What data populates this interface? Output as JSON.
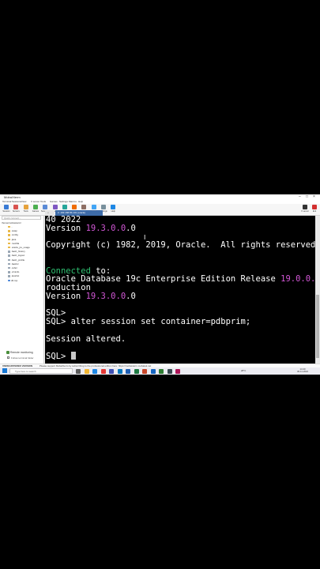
{
  "window": {
    "title": "MobaXterm"
  },
  "menu": [
    "Terminal",
    "Sessions",
    "View",
    "X server",
    "Tools",
    "Games",
    "Settings",
    "Macros",
    "Help"
  ],
  "toolbar": [
    {
      "label": "Session",
      "icon": "session-icon",
      "color": "#3a7bd5"
    },
    {
      "label": "Servers",
      "icon": "servers-icon",
      "color": "#d9534f"
    },
    {
      "label": "Tools",
      "icon": "tools-icon",
      "color": "#e6a23c"
    },
    {
      "label": "Games",
      "icon": "games-icon",
      "color": "#4caf50"
    },
    {
      "label": "Sessions",
      "icon": "sessions-icon",
      "color": "#5b8bd6"
    },
    {
      "label": "View",
      "icon": "view-icon",
      "color": "#7e57c2"
    },
    {
      "label": "Split",
      "icon": "split-icon",
      "color": "#26a69a"
    },
    {
      "label": "MultiExec",
      "icon": "multiexec-icon",
      "color": "#ef6c00"
    },
    {
      "label": "Tunneling",
      "icon": "tunneling-icon",
      "color": "#8d6e63"
    },
    {
      "label": "Packages",
      "icon": "packages-icon",
      "color": "#42a5f5"
    },
    {
      "label": "Settings",
      "icon": "settings-icon",
      "color": "#78909c"
    },
    {
      "label": "Help",
      "icon": "help-icon",
      "color": "#1e88e5"
    }
  ],
  "toolbar_right": [
    {
      "label": "X server",
      "icon": "x-server-icon",
      "color": "#333333"
    },
    {
      "label": "Exit",
      "icon": "exit-icon",
      "color": "#d32f2f"
    }
  ],
  "sidebar": {
    "search_placeholder": "Quick connect...",
    "header": "/home/mobaxterm/",
    "items": [
      {
        "name": "..",
        "type": "folder"
      },
      {
        "name": ".swap",
        "type": "folder"
      },
      {
        "name": ".config",
        "type": "folder"
      },
      {
        "name": ".java",
        "type": "folder"
      },
      {
        "name": ".mozilla",
        "type": "folder"
      },
      {
        "name": ".oracle_jre_usage",
        "type": "folder"
      },
      {
        "name": ".bash_history",
        "type": "file"
      },
      {
        "name": ".bash_logout",
        "type": "file"
      },
      {
        "name": ".bash_profile",
        "type": "file"
      },
      {
        "name": ".bashrc",
        "type": "file"
      },
      {
        "name": ".cshrc",
        "type": "file"
      },
      {
        "name": ".viminfo",
        "type": "file"
      },
      {
        "name": ".lesshst",
        "type": "file"
      },
      {
        "name": "db.rsp",
        "type": "db"
      }
    ],
    "remote_monitoring": "Remote monitoring",
    "follow_terminal": "Follow terminal folder"
  },
  "tabs": {
    "home": "⌂",
    "active": "2. 192.168.56.101 (oracle)"
  },
  "terminal": {
    "lines": [
      [
        {
          "t": "40 2022"
        }
      ],
      [
        {
          "t": "Version "
        },
        {
          "t": "19.3.0.0",
          "c": "mag"
        },
        {
          "t": ".0"
        }
      ],
      [
        {
          "t": ""
        }
      ],
      [
        {
          "t": "Copyright (c) 1982, 2019, Oracle.  All rights reserved."
        }
      ],
      [
        {
          "t": ""
        }
      ],
      [
        {
          "t": ""
        }
      ],
      [
        {
          "t": "Connected",
          "c": "grn"
        },
        {
          "t": " to:"
        }
      ],
      [
        {
          "t": "Oracle Database 19c Enterprise Edition Release "
        },
        {
          "t": "19.0.0.0",
          "c": "mag"
        },
        {
          "t": ".0 - P"
        }
      ],
      [
        {
          "t": "roduction"
        }
      ],
      [
        {
          "t": "Version "
        },
        {
          "t": "19.3.0.0",
          "c": "mag"
        },
        {
          "t": ".0"
        }
      ],
      [
        {
          "t": ""
        }
      ],
      [
        {
          "t": "SQL>"
        }
      ],
      [
        {
          "t": "SQL> alter session set container=pdbprim;"
        }
      ],
      [
        {
          "t": ""
        }
      ],
      [
        {
          "t": "Session altered."
        }
      ],
      [
        {
          "t": ""
        }
      ],
      [
        {
          "t": "SQL> "
        },
        {
          "t": "",
          "c": "cursor"
        }
      ]
    ]
  },
  "statusbar": {
    "edition": "UNREGISTERED VERSION",
    "message": "Please support MobaXterm by subscribing to the professional edition here: https://mobaxterm.mobatek.net"
  },
  "taskbar": {
    "search_placeholder": "Type here to search",
    "weather": "28°C",
    "time": "14:40",
    "date": "30-11-2022",
    "apps": [
      {
        "icon": "task-view-icon",
        "color": "#5c5c5c"
      },
      {
        "icon": "file-explorer-icon",
        "color": "#f2b632"
      },
      {
        "icon": "edge-icon",
        "color": "#1e88e5"
      },
      {
        "icon": "chrome-icon",
        "color": "#e53935"
      },
      {
        "icon": "store-icon",
        "color": "#3f51b5"
      },
      {
        "icon": "mail-icon",
        "color": "#0277bd"
      },
      {
        "icon": "word-icon",
        "color": "#1e5eb3"
      },
      {
        "icon": "excel-icon",
        "color": "#1f7a43"
      },
      {
        "icon": "powerpoint-icon",
        "color": "#c8472a"
      },
      {
        "icon": "virtualbox-icon",
        "color": "#1565c0"
      },
      {
        "icon": "mobaxterm-icon",
        "color": "#2e7d32"
      },
      {
        "icon": "obs-icon",
        "color": "#37474f"
      },
      {
        "icon": "photos-icon",
        "color": "#ad1457"
      }
    ]
  }
}
